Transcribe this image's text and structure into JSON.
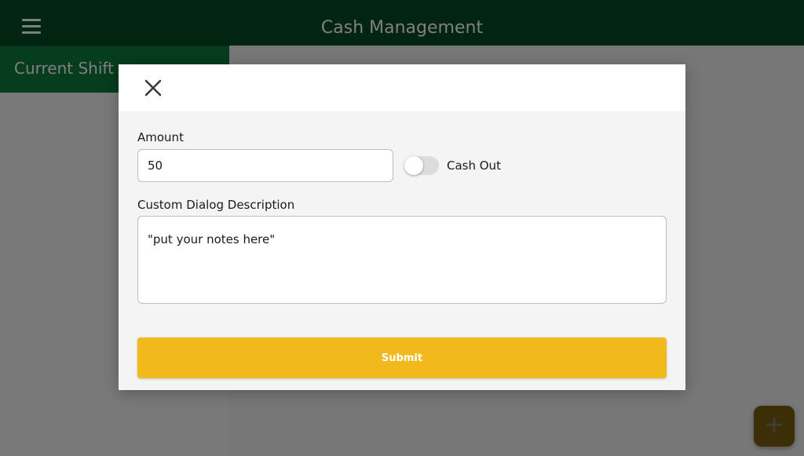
{
  "app": {
    "title": "Cash Management",
    "menu_icon": "hamburger-menu-icon"
  },
  "sidebar": {
    "tab_label": "Current Shift"
  },
  "fab": {
    "icon": "plus-icon",
    "glyph": "+"
  },
  "dialog": {
    "close_icon": "close-icon",
    "amount": {
      "label": "Amount",
      "value": "50"
    },
    "cash_out": {
      "label": "Cash Out",
      "checked": false
    },
    "description": {
      "label": "Custom Dialog Description",
      "value": "\"put your notes here\""
    },
    "submit_label": "Submit"
  },
  "colors": {
    "topbar": "#024a23",
    "side_tab": "#0b7a3b",
    "accent": "#f2b91d"
  }
}
